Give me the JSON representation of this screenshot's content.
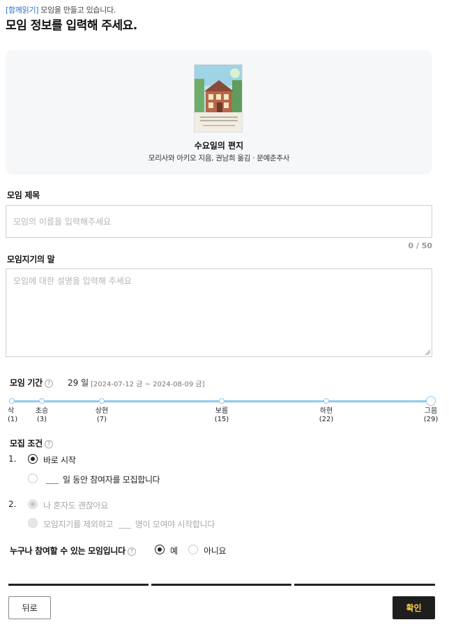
{
  "notice": {
    "tag": "[함께읽기]",
    "text": "모임을 만들고 있습니다."
  },
  "page_title": "모임 정보를 입력해 주세요.",
  "book": {
    "title": "수요일의 편지",
    "meta": "모리사와 아키오 지음, 권남희 옮김 · 문예춘추사",
    "cover_title": "수요일의 편지"
  },
  "group_title": {
    "label": "모임 제목",
    "placeholder": "모임의 이름을 입력해주세요",
    "value": "",
    "counter": "0 / 50"
  },
  "host_message": {
    "label": "모임지기의 말",
    "placeholder": "모임에 대한 설명을 입력해 주세요",
    "value": ""
  },
  "period": {
    "label": "모임 기간",
    "days": "29 일",
    "range": "[2024-07-12 금 ~ 2024-08-09 금]",
    "ticks": [
      {
        "name": "삭",
        "day": "(1)"
      },
      {
        "name": "초승",
        "day": "(3)"
      },
      {
        "name": "상현",
        "day": "(7)"
      },
      {
        "name": "보름",
        "day": "(15)"
      },
      {
        "name": "하현",
        "day": "(22)"
      },
      {
        "name": "그믐",
        "day": "(29)"
      }
    ]
  },
  "conditions": {
    "label": "모집 조건",
    "options": [
      {
        "number": "1.",
        "label": "바로 시작",
        "selected": true,
        "disabled": false
      },
      {
        "label": "일 동안 참여자를 모집합니다",
        "selected": false,
        "disabled": false
      },
      {
        "number": "2.",
        "label": "나 혼자도 괜찮아요",
        "selected": true,
        "disabled": true
      },
      {
        "label_before": "모임지기를 제외하고",
        "label": "명이 모여야 시작합니다",
        "selected": false,
        "disabled": true
      }
    ]
  },
  "public": {
    "question": "누구나 참여할 수 있는 모임입니다",
    "yes": "예",
    "no": "아니요",
    "selected": "yes"
  },
  "buttons": {
    "back": "뒤로",
    "confirm": "확인"
  },
  "colors": {
    "accent": "#2f6fd0",
    "timeline": "#8ccbf0",
    "confirm_bg": "#1e1e1e",
    "confirm_text": "#ffd24a"
  }
}
